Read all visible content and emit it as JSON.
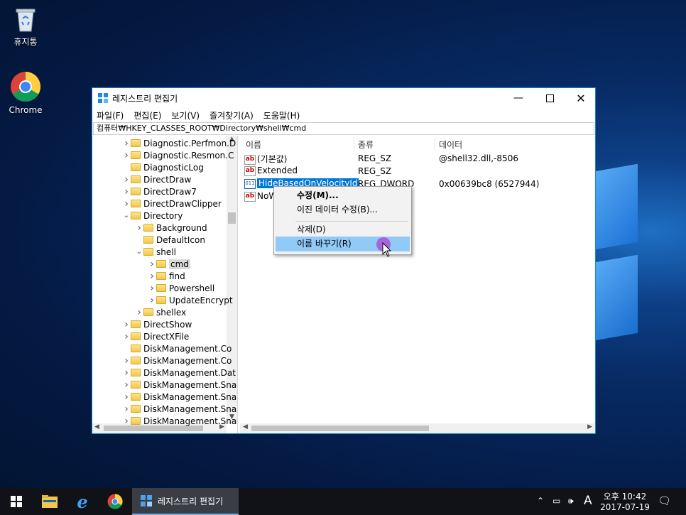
{
  "desktop": {
    "icons": [
      {
        "label": "휴지통"
      },
      {
        "label": "Chrome"
      }
    ]
  },
  "window": {
    "title": "레지스트리 편집기",
    "menu": [
      "파일(F)",
      "편집(E)",
      "보기(V)",
      "즐겨찾기(A)",
      "도움말(H)"
    ],
    "address": "컴퓨터₩HKEY_CLASSES_ROOT₩Directory₩shell₩cmd",
    "tree": [
      {
        "label": "Diagnostic.Perfmon.D",
        "level": 0,
        "expander": "collapsed"
      },
      {
        "label": "Diagnostic.Resmon.C",
        "level": 0,
        "expander": "collapsed"
      },
      {
        "label": "DiagnosticLog",
        "level": 0,
        "expander": "none"
      },
      {
        "label": "DirectDraw",
        "level": 0,
        "expander": "collapsed"
      },
      {
        "label": "DirectDraw7",
        "level": 0,
        "expander": "collapsed"
      },
      {
        "label": "DirectDrawClipper",
        "level": 0,
        "expander": "collapsed"
      },
      {
        "label": "Directory",
        "level": 0,
        "expander": "expanded"
      },
      {
        "label": "Background",
        "level": 1,
        "expander": "collapsed"
      },
      {
        "label": "DefaultIcon",
        "level": 1,
        "expander": "none"
      },
      {
        "label": "shell",
        "level": 1,
        "expander": "expanded"
      },
      {
        "label": "cmd",
        "level": 2,
        "expander": "collapsed",
        "selected": true
      },
      {
        "label": "find",
        "level": 2,
        "expander": "collapsed"
      },
      {
        "label": "Powershell",
        "level": 2,
        "expander": "collapsed"
      },
      {
        "label": "UpdateEncrypt",
        "level": 2,
        "expander": "collapsed"
      },
      {
        "label": "shellex",
        "level": 1,
        "expander": "collapsed"
      },
      {
        "label": "DirectShow",
        "level": 0,
        "expander": "collapsed"
      },
      {
        "label": "DirectXFile",
        "level": 0,
        "expander": "collapsed"
      },
      {
        "label": "DiskManagement.Co",
        "level": 0,
        "expander": "none"
      },
      {
        "label": "DiskManagement.Co",
        "level": 0,
        "expander": "collapsed"
      },
      {
        "label": "DiskManagement.Dat",
        "level": 0,
        "expander": "collapsed"
      },
      {
        "label": "DiskManagement.Sna",
        "level": 0,
        "expander": "collapsed"
      },
      {
        "label": "DiskManagement.Sna",
        "level": 0,
        "expander": "collapsed"
      },
      {
        "label": "DiskManagement.Sna",
        "level": 0,
        "expander": "collapsed"
      },
      {
        "label": "DiskManagement.Sna",
        "level": 0,
        "expander": "collapsed"
      }
    ],
    "columns": {
      "name": "이름",
      "type": "종류",
      "data": "데이터"
    },
    "values": [
      {
        "icon": "string-value-icon",
        "name": "(기본값)",
        "type": "REG_SZ",
        "data": "@shell32.dll,-8506"
      },
      {
        "icon": "string-value-icon",
        "name": "Extended",
        "type": "REG_SZ",
        "data": ""
      },
      {
        "icon": "dword-value-icon",
        "name": "HideBasedOnVelocityId",
        "type": "REG_DWORD",
        "data": "0x00639bc8 (6527944)",
        "selected": true
      },
      {
        "icon": "string-value-icon",
        "name": "NoW",
        "type": "",
        "data": ""
      }
    ]
  },
  "context_menu": {
    "items": [
      "수정(M)...",
      "이진 데이터 수정(B)...",
      "삭제(D)",
      "이름 바꾸기(R)"
    ]
  },
  "taskbar": {
    "active_app": "레지스트리 편집기",
    "ime": "A",
    "time": "오후 10:42",
    "date": "2017-07-19"
  },
  "colors": {
    "accent": "#1883d7",
    "menu_highlight": "#91c9f7",
    "selection": "#0078d7"
  }
}
